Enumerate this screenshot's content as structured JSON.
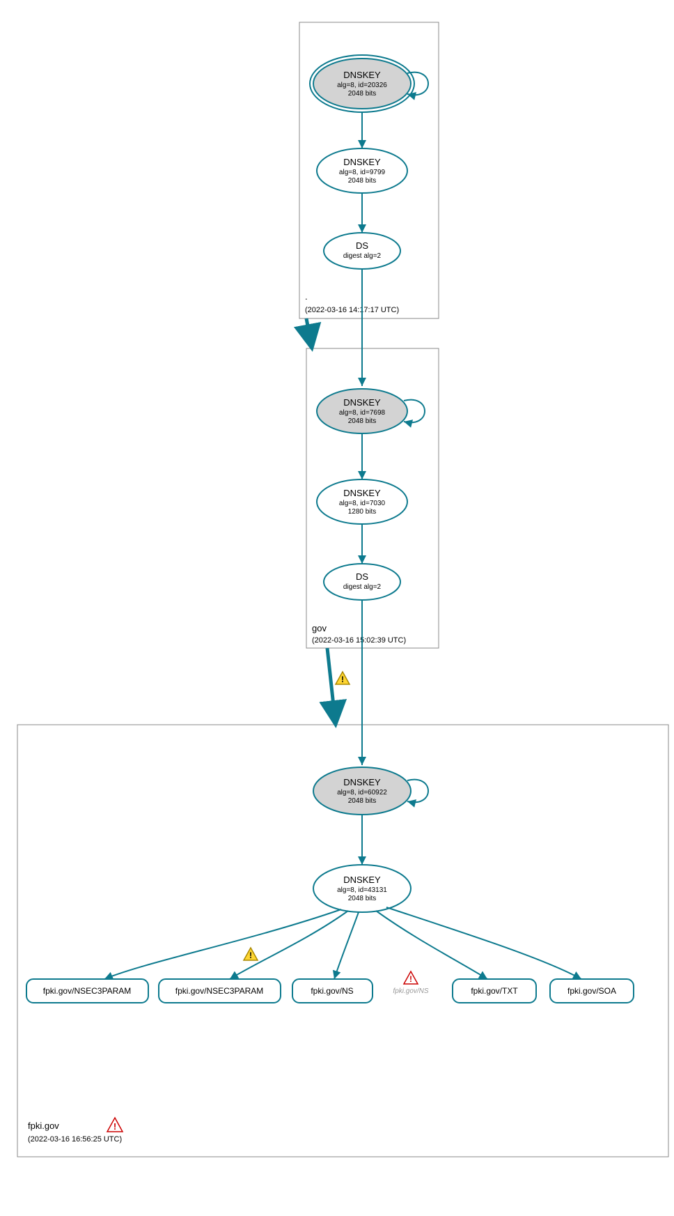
{
  "zones": {
    "root": {
      "label": ".",
      "timestamp": "(2022-03-16 14:17:17 UTC)",
      "ksk": {
        "title": "DNSKEY",
        "sub1": "alg=8, id=20326",
        "sub2": "2048 bits"
      },
      "zsk": {
        "title": "DNSKEY",
        "sub1": "alg=8, id=9799",
        "sub2": "2048 bits"
      },
      "ds": {
        "title": "DS",
        "sub1": "digest alg=2"
      }
    },
    "gov": {
      "label": "gov",
      "timestamp": "(2022-03-16 15:02:39 UTC)",
      "ksk": {
        "title": "DNSKEY",
        "sub1": "alg=8, id=7698",
        "sub2": "2048 bits"
      },
      "zsk": {
        "title": "DNSKEY",
        "sub1": "alg=8, id=7030",
        "sub2": "1280 bits"
      },
      "ds": {
        "title": "DS",
        "sub1": "digest alg=2"
      }
    },
    "fpki": {
      "label": "fpki.gov",
      "timestamp": "(2022-03-16 16:56:25 UTC)",
      "ksk": {
        "title": "DNSKEY",
        "sub1": "alg=8, id=60922",
        "sub2": "2048 bits"
      },
      "zsk": {
        "title": "DNSKEY",
        "sub1": "alg=8, id=43131",
        "sub2": "2048 bits"
      },
      "records": {
        "r1": "fpki.gov/NSEC3PARAM",
        "r2": "fpki.gov/NSEC3PARAM",
        "r3": "fpki.gov/NS",
        "r4": "fpki.gov/NS",
        "r5": "fpki.gov/TXT",
        "r6": "fpki.gov/SOA"
      }
    }
  }
}
